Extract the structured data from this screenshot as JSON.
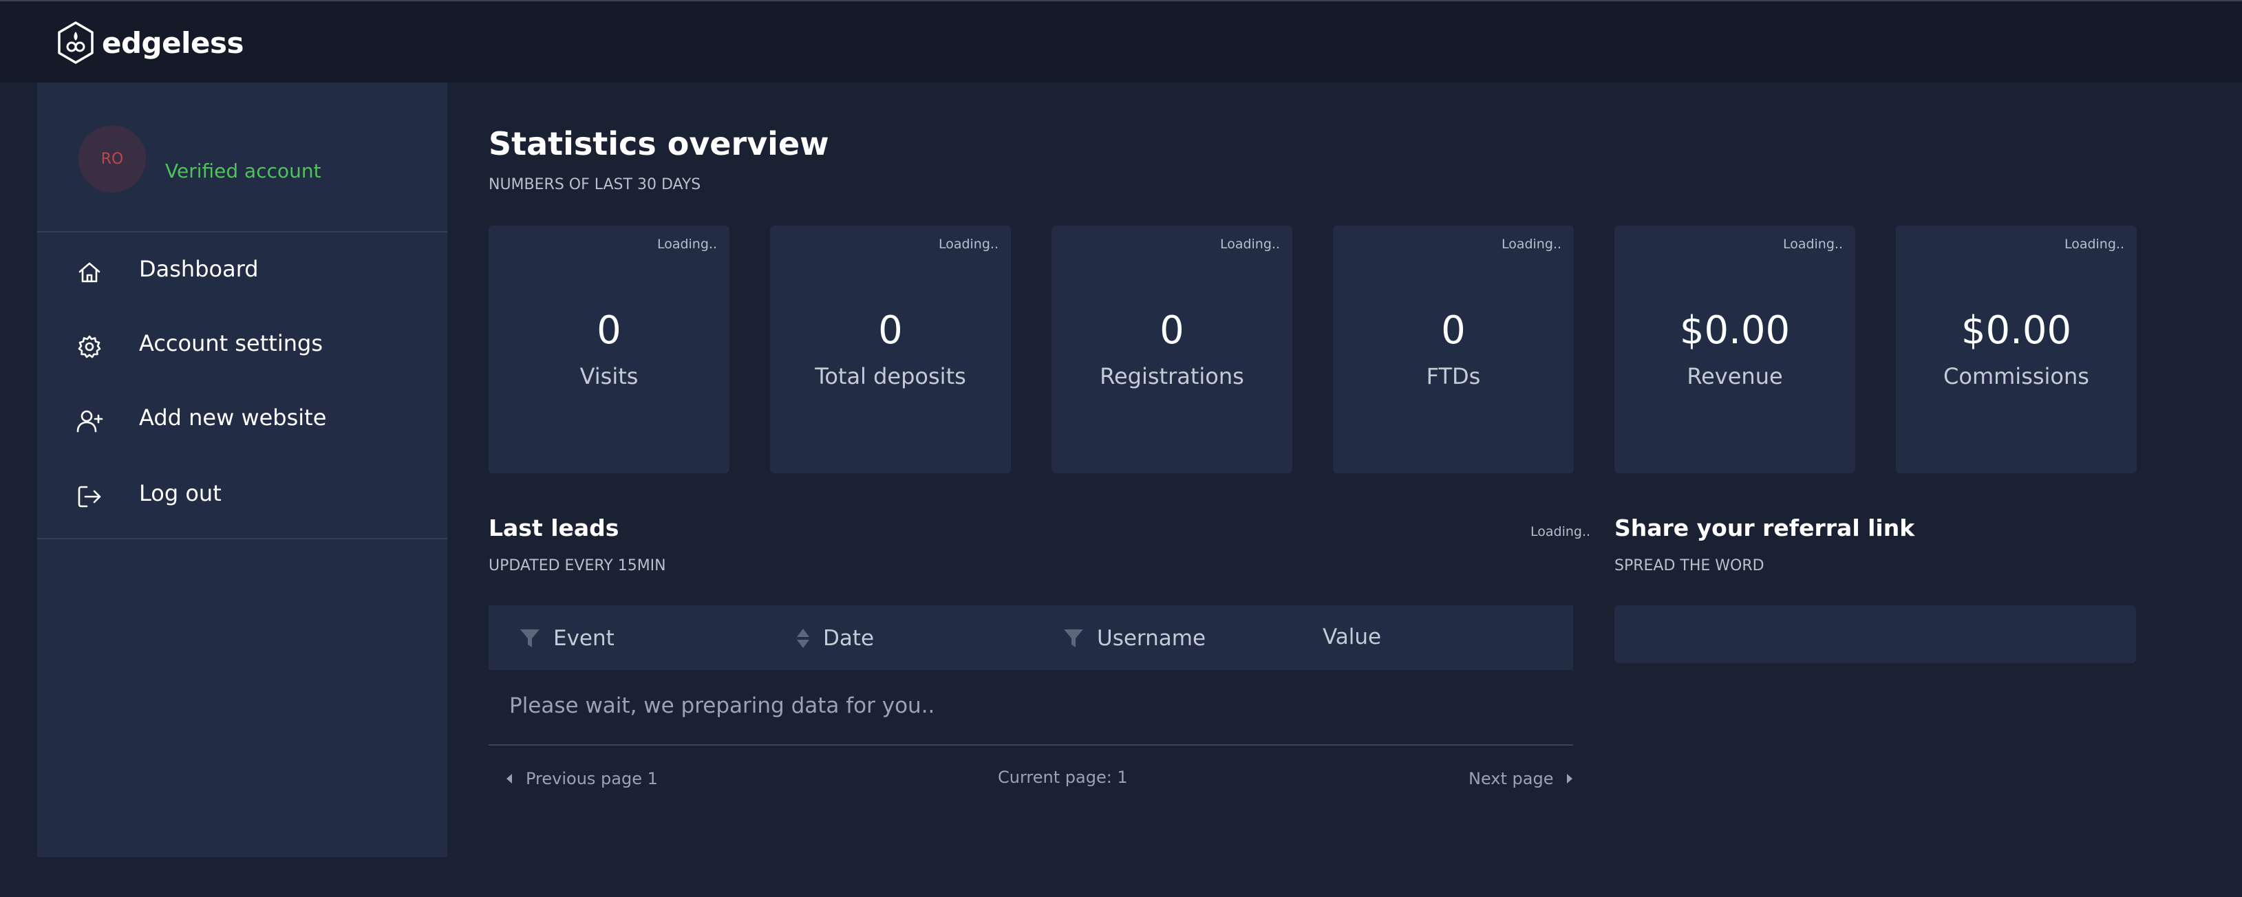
{
  "app": {
    "brand": "edgeless"
  },
  "profile": {
    "initials": "RO",
    "status": "Verified account"
  },
  "nav": [
    {
      "label": "Dashboard",
      "icon": "home-icon"
    },
    {
      "label": "Account settings",
      "icon": "gear-icon"
    },
    {
      "label": "Add new website",
      "icon": "user-plus-icon"
    },
    {
      "label": "Log out",
      "icon": "logout-icon"
    }
  ],
  "stats": {
    "title": "Statistics overview",
    "subtitle": "NUMBERS OF LAST 30 DAYS",
    "cards": [
      {
        "value": "0",
        "label": "Visits",
        "loading": "Loading.."
      },
      {
        "value": "0",
        "label": "Total deposits",
        "loading": "Loading.."
      },
      {
        "value": "0",
        "label": "Registrations",
        "loading": "Loading.."
      },
      {
        "value": "0",
        "label": "FTDs",
        "loading": "Loading.."
      },
      {
        "value": "$0.00",
        "label": "Revenue",
        "loading": "Loading.."
      },
      {
        "value": "$0.00",
        "label": "Commissions",
        "loading": "Loading.."
      }
    ]
  },
  "leads": {
    "title": "Last leads",
    "subtitle": "UPDATED EVERY 15MIN",
    "loading": "Loading..",
    "columns": [
      "Event",
      "Date",
      "Username",
      "Value"
    ],
    "empty_message": "Please wait, we preparing data for you..",
    "prev_label": "Previous page 1",
    "current_label": "Current page: 1",
    "next_label": "Next page"
  },
  "referral": {
    "title": "Share your referral link",
    "subtitle": "SPREAD THE WORD",
    "link": ""
  },
  "colors": {
    "background": "#1a2133",
    "panel": "#222c45",
    "topbar": "#141a28",
    "verified": "#4fc25a",
    "avatar_text": "#b8484e"
  }
}
